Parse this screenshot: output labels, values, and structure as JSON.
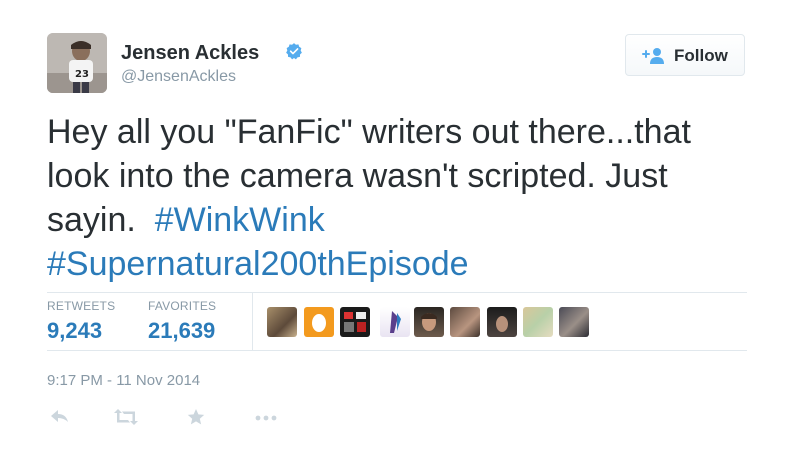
{
  "colors": {
    "text": "#292f33",
    "secondary": "#8899a6",
    "link": "#2b7bb9",
    "verified": "#55acee",
    "border": "#e1e8ed",
    "icon": "#ccd6dd"
  },
  "user": {
    "display_name": "Jensen Ackles",
    "screen_name": "@JensenAckles",
    "verified_icon": "verified-badge-icon",
    "avatar_icon": "profile-photo"
  },
  "follow_button": {
    "label": "Follow",
    "icon": "add-user-icon"
  },
  "tweet": {
    "segments": [
      "Hey all you \"FanFic\" writers out there...that",
      "look into the camera wasn't scripted.  Just",
      "sayin.  "
    ],
    "hashtags": [
      "#WinkWink",
      "#Supernatural200thEpisode"
    ]
  },
  "stats": {
    "retweets_label": "RETWEETS",
    "retweets_count": "9,243",
    "favorites_label": "FAVORITES",
    "favorites_count": "21,639"
  },
  "favoriters": [
    {
      "icon": "user-avatar"
    },
    {
      "icon": "user-avatar"
    },
    {
      "icon": "user-avatar"
    },
    {
      "icon": "user-avatar"
    },
    {
      "icon": "user-avatar"
    },
    {
      "icon": "user-avatar"
    },
    {
      "icon": "user-avatar"
    },
    {
      "icon": "user-avatar"
    },
    {
      "icon": "user-avatar"
    }
  ],
  "timestamp": "9:17 PM - 11 Nov 2014",
  "actions": {
    "reply_icon": "reply-icon",
    "retweet_icon": "retweet-icon",
    "favorite_icon": "star-icon",
    "more_icon": "more-dots-icon"
  }
}
